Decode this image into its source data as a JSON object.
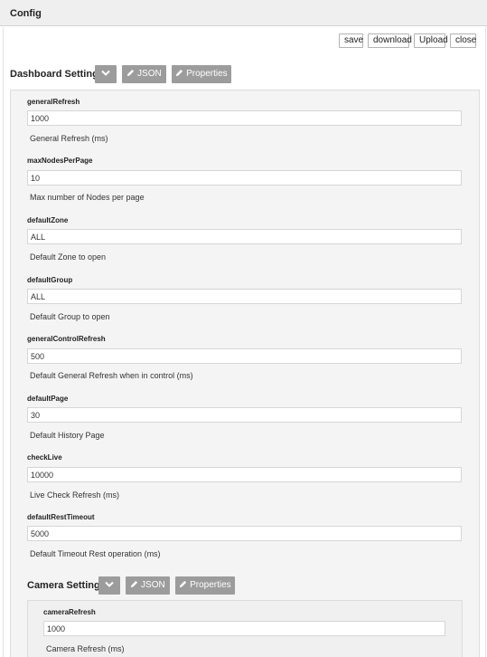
{
  "window": {
    "title": "Config"
  },
  "toolbar": {
    "save_label": "save",
    "download_label": "download",
    "upload_label": "Upload",
    "close_label": "close"
  },
  "dashboard": {
    "title": "Dashboard Settings",
    "json_label": "JSON",
    "properties_label": "Properties",
    "fields": [
      {
        "name": "generalRefresh",
        "value": "1000",
        "description": "General Refresh (ms)"
      },
      {
        "name": "maxNodesPerPage",
        "value": "10",
        "description": "Max number of Nodes per page"
      },
      {
        "name": "defaultZone",
        "value": "ALL",
        "description": "Default Zone to open"
      },
      {
        "name": "defaultGroup",
        "value": "ALL",
        "description": "Default Group to open"
      },
      {
        "name": "generalControlRefresh",
        "value": "500",
        "description": "Default General Refresh when in control (ms)"
      },
      {
        "name": "defaultPage",
        "value": "30",
        "description": "Default History Page"
      },
      {
        "name": "checkLive",
        "value": "10000",
        "description": "Live Check Refresh (ms)"
      },
      {
        "name": "defaultRestTimeout",
        "value": "5000",
        "description": "Default Timeout Rest operation (ms)"
      }
    ]
  },
  "camera": {
    "title": "Camera Settings",
    "json_label": "JSON",
    "properties_label": "Properties",
    "fields": [
      {
        "name": "cameraRefresh",
        "value": "1000",
        "description": "Camera Refresh (ms)"
      }
    ]
  },
  "icons": {
    "collapse": "chevron-down-icon",
    "edit": "pencil-icon"
  }
}
